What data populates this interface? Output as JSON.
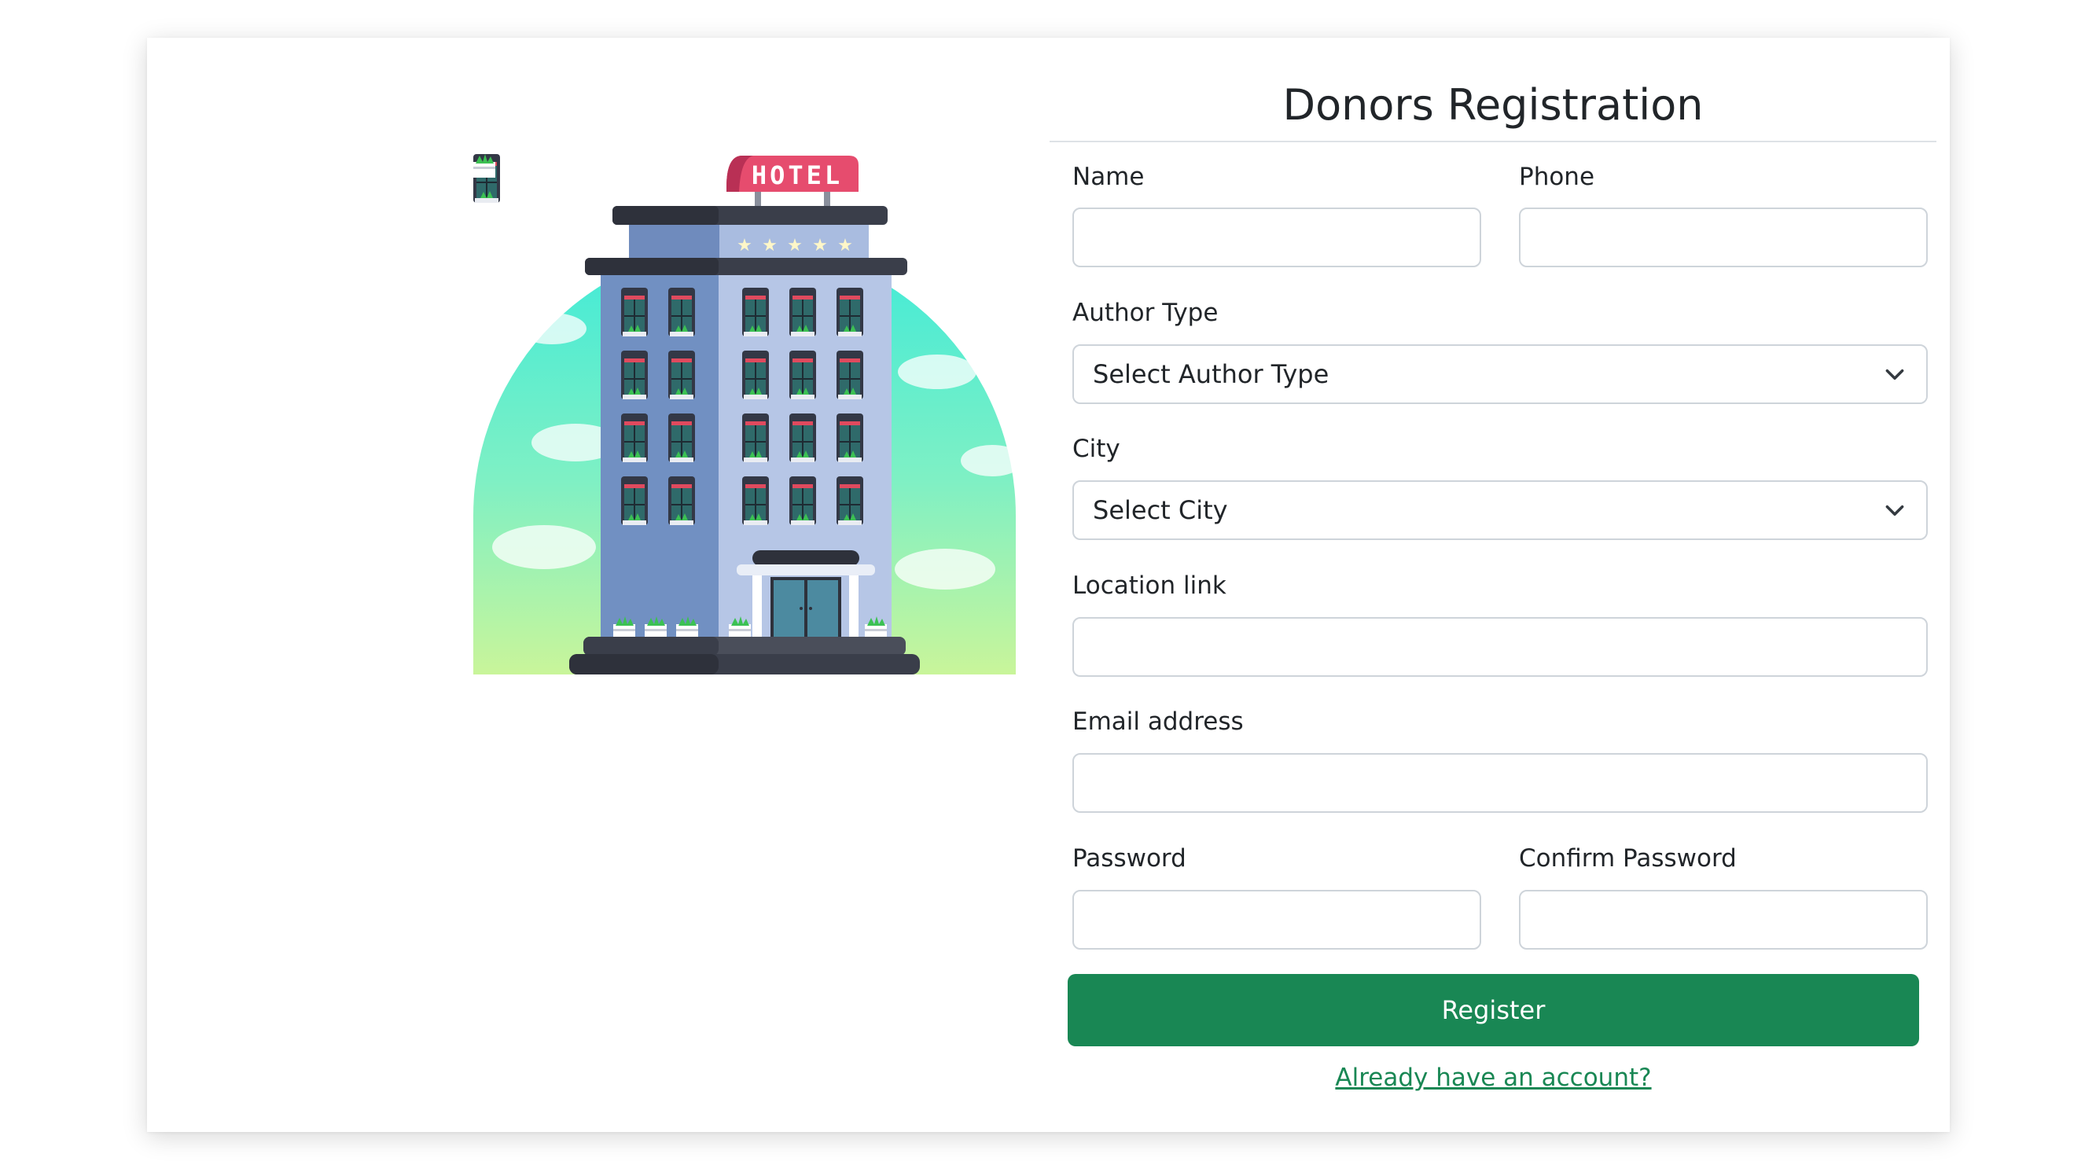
{
  "form": {
    "title": "Donors Registration",
    "fields": {
      "name": {
        "label": "Name",
        "value": ""
      },
      "phone": {
        "label": "Phone",
        "value": ""
      },
      "author_type": {
        "label": "Author Type",
        "selected": "Select Author Type"
      },
      "city": {
        "label": "City",
        "selected": "Select City"
      },
      "location_link": {
        "label": "Location link",
        "value": ""
      },
      "email": {
        "label": "Email address",
        "value": ""
      },
      "password": {
        "label": "Password",
        "value": ""
      },
      "confirm_password": {
        "label": "Confirm Password",
        "value": ""
      }
    },
    "register_label": "Register",
    "login_link_label": "Already have an account?"
  },
  "illustration": {
    "sign_text": "HOTEL",
    "icon": "hotel-building-illustration"
  },
  "colors": {
    "primary_button": "#198754",
    "link": "#198754",
    "input_border": "#ced4da",
    "sign": "#e64c6e"
  }
}
